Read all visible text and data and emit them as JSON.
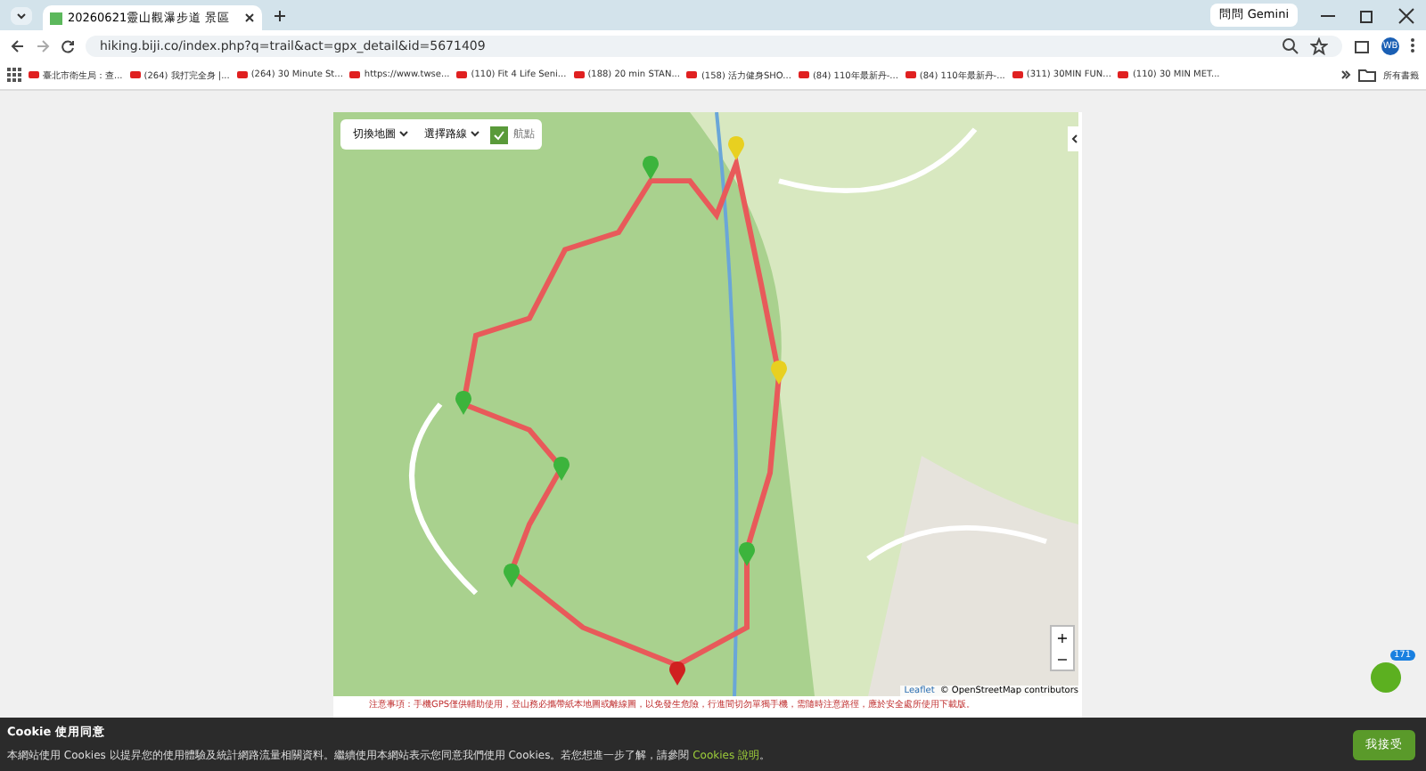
{
  "browser": {
    "tab_title": "20260621靈山觀瀑步道 景區",
    "gemini_button": "問問 Gemini",
    "url": "hiking.biji.co/index.php?q=trail&act=gpx_detail&id=5671409",
    "profile": "WB",
    "bookmarks": [
      {
        "label": "臺北市衛生局：查..."
      },
      {
        "label": "(264) 我打完全身 |..."
      },
      {
        "label": "(264) 30 Minute St..."
      },
      {
        "label": "https://www.twse..."
      },
      {
        "label": "(110) Fit 4 Life Seni..."
      },
      {
        "label": "(188) 20 min STAN..."
      },
      {
        "label": "(158) 活力健身SHO..."
      },
      {
        "label": "(84) 110年最新丹-..."
      },
      {
        "label": "(84) 110年最新丹-..."
      },
      {
        "label": "(311) 30MIN FUN..."
      },
      {
        "label": "(110) 30 MIN MET..."
      }
    ],
    "all_bookmarks": "所有書籤"
  },
  "map": {
    "switch_map": "切換地圖",
    "choose_route": "選擇路線",
    "waypoints": "航點",
    "waypoints_checked": true,
    "attribution_leaflet": "Leaflet",
    "attribution_osm": "© OpenStreetMap contributors",
    "zoom_in": "+",
    "zoom_out": "−",
    "pins": [
      {
        "color": "#3cb43c"
      },
      {
        "color": "#e8d020"
      },
      {
        "color": "#e8d020"
      },
      {
        "color": "#3cb43c"
      },
      {
        "color": "#3cb43c"
      },
      {
        "color": "#3cb43c"
      },
      {
        "color": "#3cb43c"
      },
      {
        "color": "#d02020"
      }
    ]
  },
  "notice": "注意事項：手機GPS僅供輔助使用，登山務必攜帶紙本地圖或離線圖，以免發生危險，行進間切勿單獨手機，需隨時注意路徑，應於安全處所使用下載版。",
  "widget_badge": "171",
  "cookie": {
    "title": "Cookie 使用同意",
    "text_before": "本網站使用 Cookies 以提昇您的使用體驗及統計網路流量相關資料。繼續使用本網站表示您同意我們使用 Cookies。若您想進一步了解，請參閱 ",
    "link": "Cookies 說明",
    "text_after": "。",
    "accept": "我接受"
  }
}
